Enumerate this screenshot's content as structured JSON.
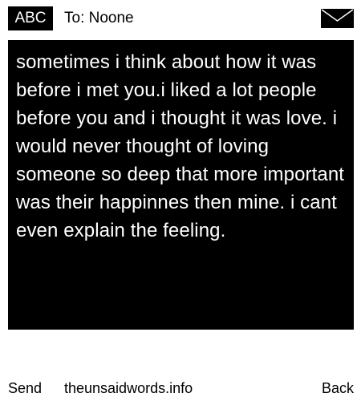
{
  "header": {
    "badge": "ABC",
    "to": "To: Noone",
    "icon": "envelope-icon"
  },
  "message": {
    "text": "sometimes i think about how it was before i met you.i liked a lot people before you and i thought it was love. i would never thought of loving someone so deep that more important was their happinnes then mine. i cant even explain the feeling."
  },
  "footer": {
    "send": "Send",
    "site": "theunsaidwords.info",
    "back": "Back"
  }
}
